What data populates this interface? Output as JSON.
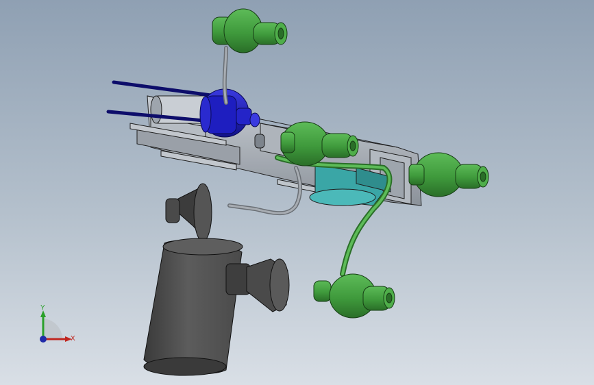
{
  "viewport": {
    "background_top": "#8fa0b3",
    "background_bottom": "#d9dfe6"
  },
  "triad": {
    "x_label": "X",
    "y_label": "Y",
    "x_color": "#c0261f",
    "y_color": "#2aa02a",
    "z_color": "#1f2aa8"
  },
  "colors": {
    "green_part": "#3f9a3c",
    "green_dark": "#2a6e28",
    "blue_part": "#1a1ab8",
    "gray_part": "#5a5a5a",
    "steel": "#a8adb4",
    "teal": "#3aa6a6"
  }
}
